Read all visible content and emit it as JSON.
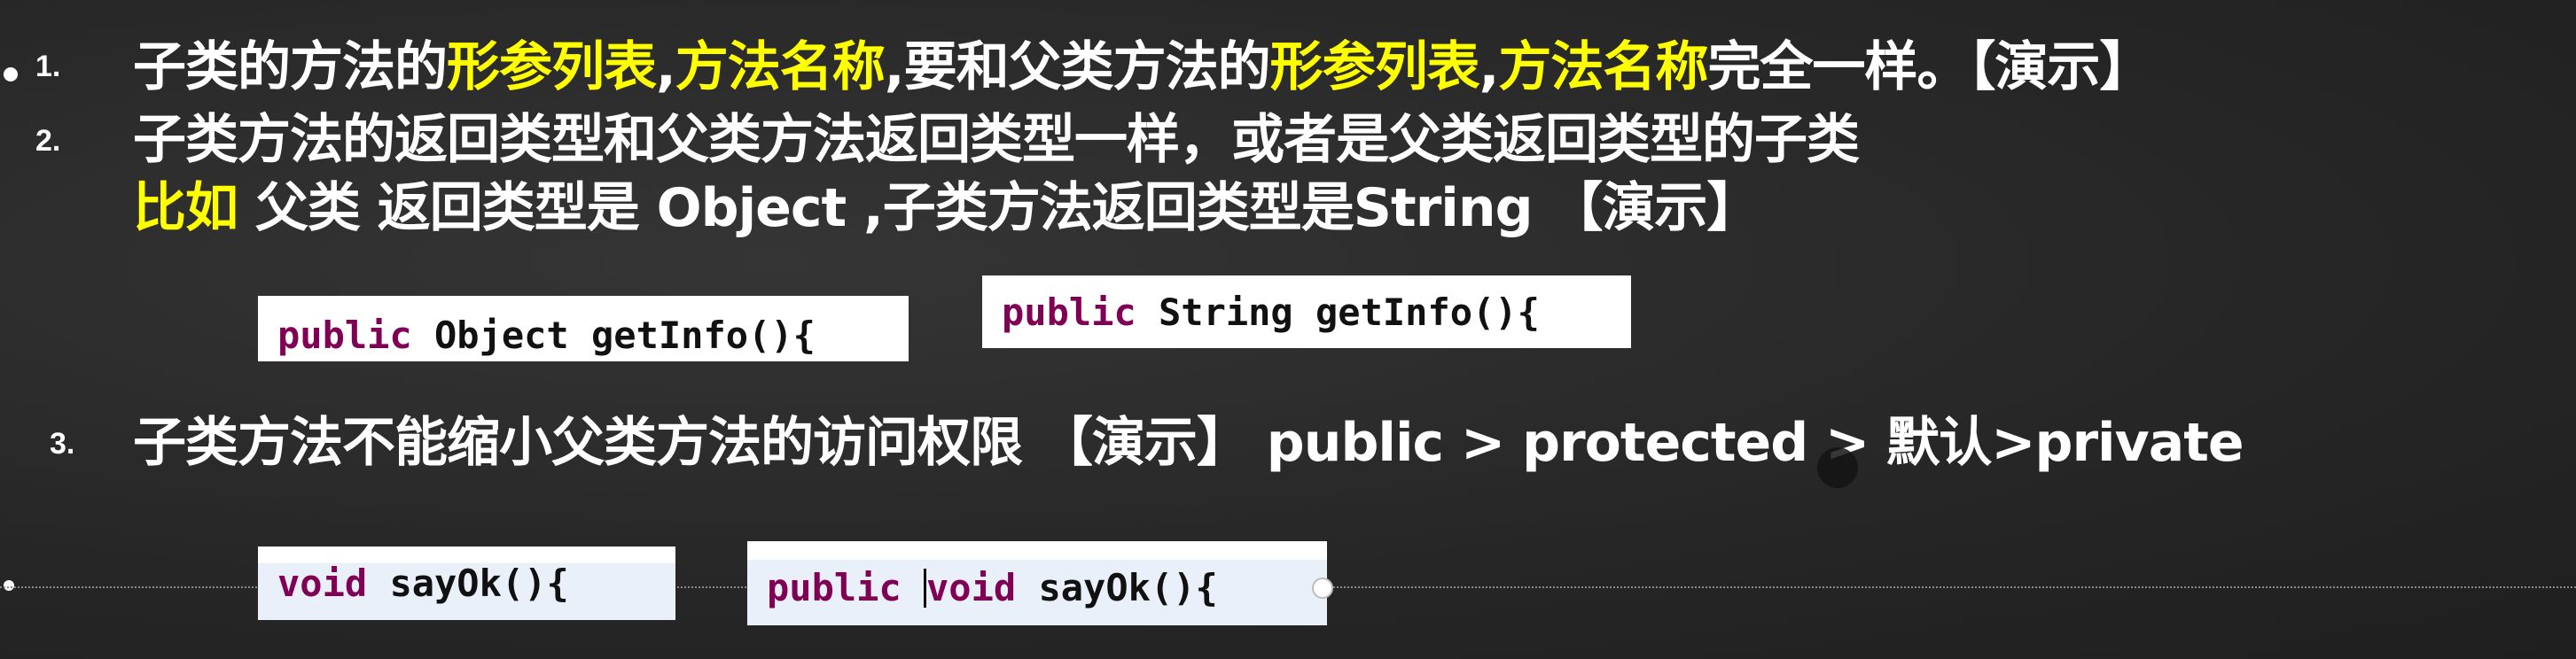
{
  "items": [
    {
      "number": "1.",
      "parts": [
        {
          "text": "子类的方法的",
          "hl": false
        },
        {
          "text": "形参列表",
          "hl": true
        },
        {
          "text": ",",
          "hl": false
        },
        {
          "text": "方法名称",
          "hl": true
        },
        {
          "text": ",要和父类方法的",
          "hl": false
        },
        {
          "text": "形参列表",
          "hl": true
        },
        {
          "text": ",",
          "hl": false
        },
        {
          "text": "方法名称",
          "hl": true
        },
        {
          "text": "完全一样。【演示】",
          "hl": false
        }
      ]
    },
    {
      "number": "2.",
      "line1": "子类方法的返回类型和父类方法返回类型一样，或者是父类返回类型的子类",
      "line2_highlight": "比如",
      "line2_rest": " 父类 返回类型是 Object ,子类方法返回类型是String 【演示】"
    },
    {
      "number": "3.",
      "text": "子类方法不能缩小父类方法的访问权限 【演示】 public > protected > 默认>private"
    }
  ],
  "code": {
    "parent_getinfo": {
      "kw": "public",
      "rest": " Object getInfo(){"
    },
    "child_getinfo": {
      "kw": "public",
      "rest": " String getInfo(){"
    },
    "parent_sayok": {
      "kw": "void",
      "rest": " sayOk(){"
    },
    "child_sayok": {
      "kw1": "public",
      "kw2": "void",
      "rest": " sayOk(){"
    }
  },
  "colors": {
    "highlight": "#ffff00",
    "keyword": "#7f0055"
  }
}
